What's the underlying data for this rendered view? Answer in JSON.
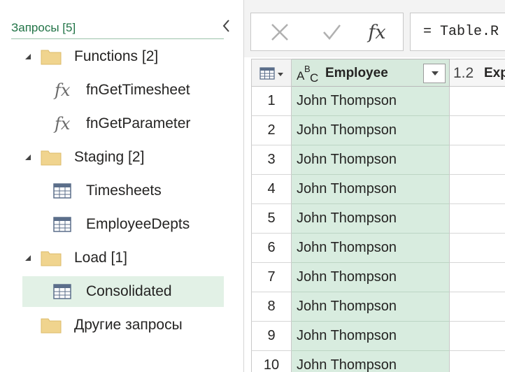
{
  "queries_pane": {
    "header": "Запросы [5]",
    "collapse_icon": "chevron-left-icon",
    "tree": [
      {
        "type": "folder",
        "label": "Functions [2]",
        "expanded": true
      },
      {
        "type": "function",
        "label": "fnGetTimesheet",
        "icon": "fx"
      },
      {
        "type": "function",
        "label": "fnGetParameter",
        "icon": "fx"
      },
      {
        "type": "folder",
        "label": "Staging [2]",
        "expanded": true
      },
      {
        "type": "table",
        "label": "Timesheets"
      },
      {
        "type": "table",
        "label": "EmployeeDepts"
      },
      {
        "type": "folder",
        "label": "Load [1]",
        "expanded": true
      },
      {
        "type": "table",
        "label": "Consolidated",
        "selected": true
      },
      {
        "type": "folder",
        "label": "Другие запросы",
        "expanded": false
      }
    ]
  },
  "formula_bar": {
    "cancel_icon": "close-icon",
    "commit_icon": "checkmark-icon",
    "fx_label": "fx",
    "formula": "= Table.R"
  },
  "grid": {
    "columns": [
      {
        "type_label": "ABC",
        "name": "Employee",
        "selected": true
      },
      {
        "type_label": "1.2",
        "name": "Exp"
      }
    ],
    "rows": [
      {
        "num": "1",
        "employee": "John Thompson"
      },
      {
        "num": "2",
        "employee": "John Thompson"
      },
      {
        "num": "3",
        "employee": "John Thompson"
      },
      {
        "num": "4",
        "employee": "John Thompson"
      },
      {
        "num": "5",
        "employee": "John Thompson"
      },
      {
        "num": "6",
        "employee": "John Thompson"
      },
      {
        "num": "7",
        "employee": "John Thompson"
      },
      {
        "num": "8",
        "employee": "John Thompson"
      },
      {
        "num": "9",
        "employee": "John Thompson"
      },
      {
        "num": "10",
        "employee": "John Thompson"
      }
    ]
  },
  "colors": {
    "accent_green": "#217346",
    "selected_row_bg": "#e2f1e6",
    "selected_column_bg": "#d8ecdf",
    "folder_yellow": "#f0d48e"
  }
}
